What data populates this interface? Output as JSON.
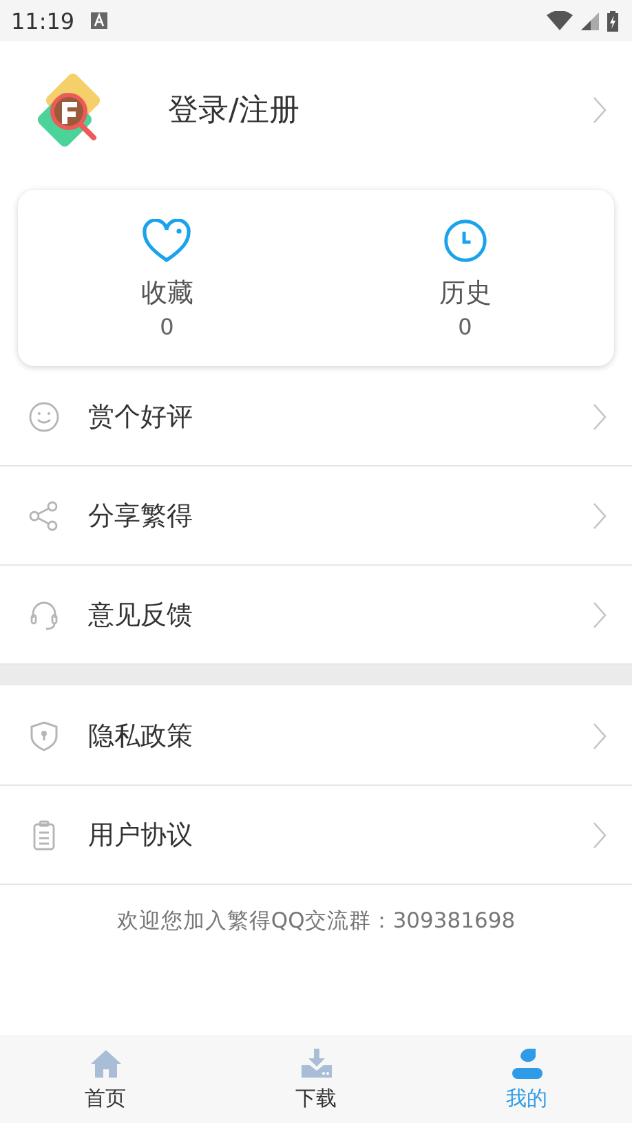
{
  "status_bar": {
    "time": "11:19"
  },
  "login": {
    "label": "登录/注册"
  },
  "stats": [
    {
      "kind": "favorites",
      "label": "收藏",
      "count": "0"
    },
    {
      "kind": "history",
      "label": "历史",
      "count": "0"
    }
  ],
  "menu_groups": [
    [
      {
        "kind": "rate",
        "label": "赏个好评"
      },
      {
        "kind": "share",
        "label": "分享繁得"
      },
      {
        "kind": "feedback",
        "label": "意见反馈"
      }
    ],
    [
      {
        "kind": "privacy",
        "label": "隐私政策"
      },
      {
        "kind": "agreement",
        "label": "用户协议"
      }
    ]
  ],
  "footer_note": "欢迎您加入繁得QQ交流群：309381698",
  "tabs": [
    {
      "kind": "home",
      "label": "首页",
      "selected": false
    },
    {
      "kind": "download",
      "label": "下载",
      "selected": false
    },
    {
      "kind": "profile",
      "label": "我的",
      "selected": true
    }
  ]
}
